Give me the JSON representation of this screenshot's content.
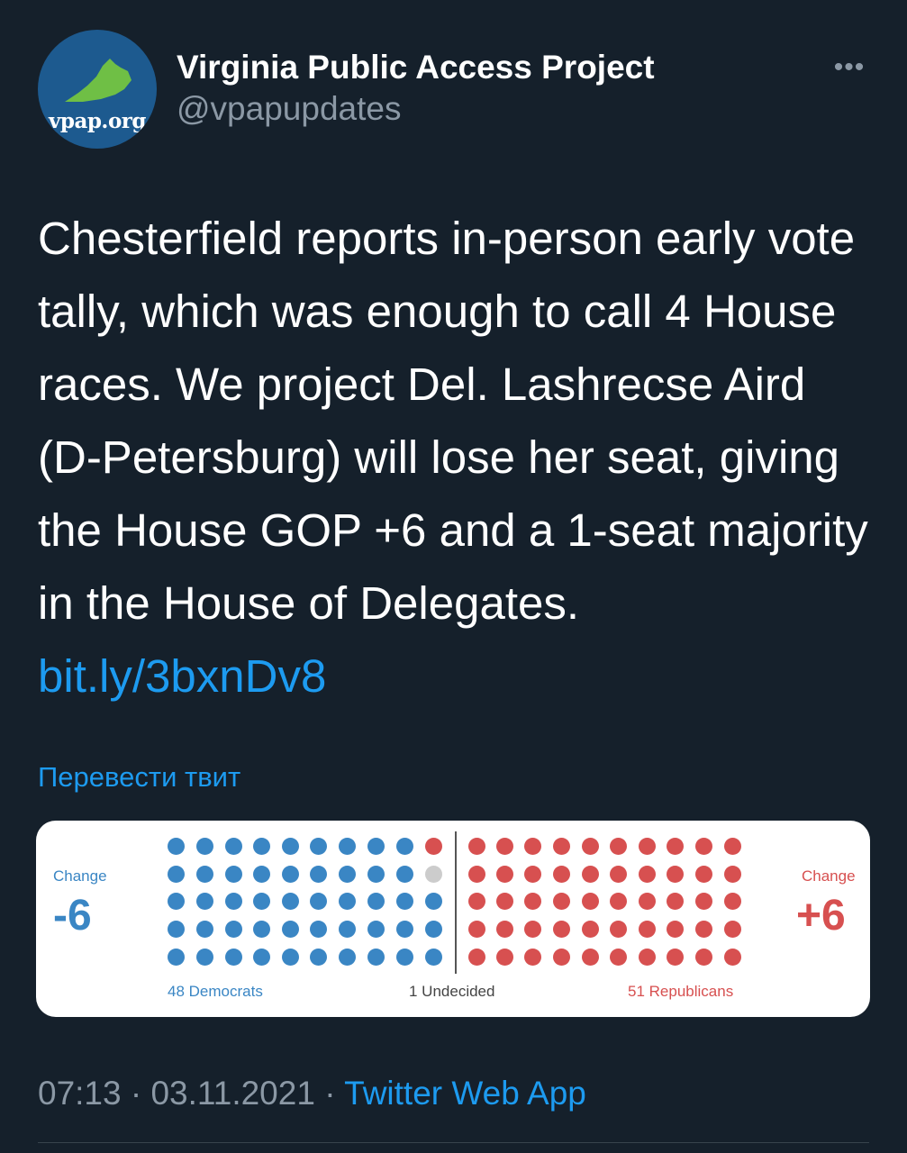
{
  "author": {
    "avatar_text": "vpap.org",
    "name": "Virginia Public Access Project",
    "handle": "@vpapupdates"
  },
  "more_label": "•••",
  "tweet": {
    "text": "Chesterfield reports in-person early vote tally, which was enough to call 4 House races. We project Del. Lashrecse Aird (D-Petersburg) will lose her seat, giving the House GOP +6 and a 1-seat majority in the House of Delegates.  ",
    "link": "bit.ly/3bxnDv8"
  },
  "translate_label": "Перевести твит",
  "card": {
    "left": {
      "label": "Change",
      "value": "-6"
    },
    "right": {
      "label": "Change",
      "value": "+6"
    },
    "legend": {
      "democrats": "48 Democrats",
      "undecided": "1 Undecided",
      "republicans": "51 Republicans"
    },
    "colors": {
      "democrat": "#3a86c4",
      "republican": "#d75050",
      "undecided": "#cccccc"
    },
    "seats": {
      "democrats": 48,
      "undecided": 1,
      "republicans": 51
    }
  },
  "meta": {
    "time": "07:13",
    "date": "03.11.2021",
    "app": "Twitter Web App"
  }
}
